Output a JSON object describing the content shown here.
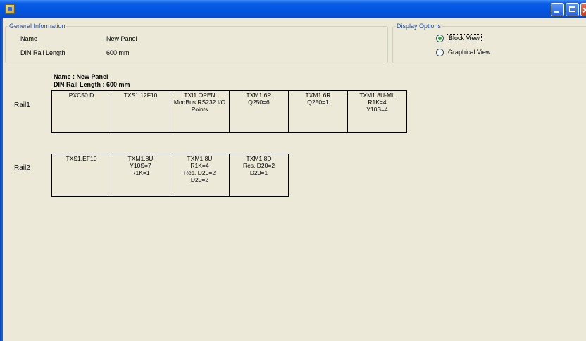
{
  "window": {
    "title": "",
    "colors": {
      "titlebar": "#0155e0",
      "background": "#ece9d8",
      "legend": "#1a4fb5"
    }
  },
  "general_information": {
    "legend": "General Information",
    "name_label": "Name",
    "name_value": "New Panel",
    "din_label": "DIN Rail Length",
    "din_value": "600 mm"
  },
  "display_options": {
    "legend": "Display Options",
    "options": [
      {
        "label": "Block View",
        "selected": true
      },
      {
        "label": "Graphical View",
        "selected": false
      }
    ]
  },
  "panel": {
    "name_heading": "Name : New Panel",
    "din_heading": "DIN Rail Length : 600 mm",
    "rails": [
      {
        "label": "Rail1",
        "modules": [
          {
            "lines": [
              "PXC50.D"
            ]
          },
          {
            "lines": [
              "TXS1.12F10"
            ]
          },
          {
            "lines": [
              "TXI1.OPEN",
              "ModBus RS232 I/O",
              "Points"
            ]
          },
          {
            "lines": [
              "TXM1.6R",
              "Q250=6"
            ]
          },
          {
            "lines": [
              "TXM1.6R",
              "Q250=1"
            ]
          },
          {
            "lines": [
              "TXM1.8U-ML",
              "R1K=4",
              "Y10S=4"
            ]
          }
        ]
      },
      {
        "label": "Rail2",
        "modules": [
          {
            "lines": [
              "TXS1.EF10"
            ]
          },
          {
            "lines": [
              "TXM1.8U",
              "Y10S=7",
              "R1K=1"
            ]
          },
          {
            "lines": [
              "TXM1.8U",
              "R1K=4",
              "Res. D20=2",
              "D20=2"
            ]
          },
          {
            "lines": [
              "TXM1.8D",
              "Res. D20=2",
              "D20=1"
            ]
          }
        ]
      }
    ]
  }
}
